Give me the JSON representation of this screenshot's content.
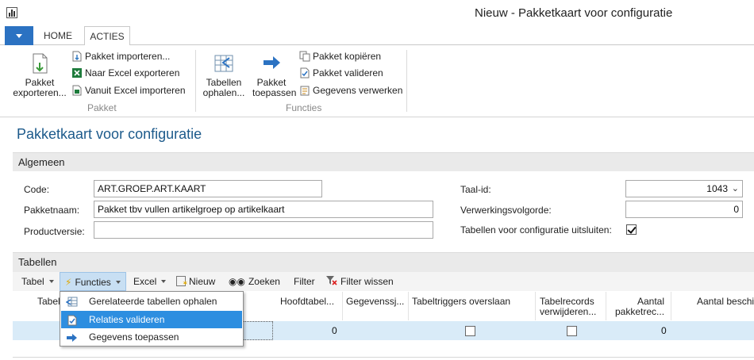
{
  "window": {
    "title": "Nieuw - Pakketkaart voor configuratie",
    "app_icon": "app-chart-icon"
  },
  "ribbon_tabs": {
    "file": "",
    "home": "HOME",
    "acties": "ACTIES"
  },
  "ribbon": {
    "pakket_group": {
      "label": "Pakket",
      "exporteren": [
        "Pakket",
        "exporteren..."
      ],
      "importeren": "Pakket importeren...",
      "excel_export": "Naar Excel exporteren",
      "excel_import": "Vanuit Excel importeren"
    },
    "functies_group": {
      "label": "Functies",
      "tabellen": [
        "Tabellen",
        "ophalen..."
      ],
      "toepassen": [
        "Pakket",
        "toepassen"
      ],
      "kopieren": "Pakket kopiëren",
      "valideren": "Pakket valideren",
      "verwerken": "Gegevens verwerken"
    }
  },
  "page": {
    "title": "Pakketkaart voor configuratie",
    "general_section": "Algemeen",
    "fields": {
      "code": {
        "label": "Code:",
        "value": "ART.GROEP.ART.KAART"
      },
      "pakketnaam": {
        "label": "Pakketnaam:",
        "value": "Pakket tbv vullen artikelgroep op artikelkaart"
      },
      "productversie": {
        "label": "Productversie:",
        "value": ""
      },
      "taal_id": {
        "label": "Taal-id:",
        "value": "1043"
      },
      "volgorde": {
        "label": "Verwerkingsvolgorde:",
        "value": "0"
      },
      "uitsluiten": {
        "label": "Tabellen voor configuratie uitsluiten:",
        "checked": true
      }
    },
    "tables_section": "Tabellen"
  },
  "grid_toolbar": {
    "tabel": "Tabel",
    "functies": "Functies",
    "excel": "Excel",
    "nieuw": "Nieuw",
    "zoeken": "Zoeken",
    "filter": "Filter",
    "filter_wissen": "Filter wissen"
  },
  "grid": {
    "headers": {
      "tabel": "Tabel",
      "hoofdtabel": "Hoofdtabel...",
      "gegevenssj": "Gegevenssj...",
      "triggers": "Tabeltriggers overslaan",
      "verwijderen": [
        "Tabelrecords",
        "verwijderen..."
      ],
      "aantal_pakket": [
        "Aantal",
        "pakketrec..."
      ],
      "aantal_besch": "Aantal beschi"
    },
    "rows": [
      {
        "hoofdtabel": "0",
        "triggers": false,
        "verwijderen": false,
        "aantal_pakket": "0"
      }
    ]
  },
  "functies_menu": {
    "items": [
      {
        "label": "Gerelateerde tabellen ophalen",
        "icon": "related-tables-icon",
        "highlighted": false
      },
      {
        "label": "Relaties valideren",
        "icon": "validate-document-icon",
        "highlighted": true
      },
      {
        "label": "Gegevens toepassen",
        "icon": "apply-arrow-icon",
        "highlighted": false
      }
    ]
  },
  "colors": {
    "accent": "#2b72c2",
    "title": "#1c5a8b",
    "highlight": "#2d8ee0",
    "row_selected": "#d9ebf8"
  }
}
